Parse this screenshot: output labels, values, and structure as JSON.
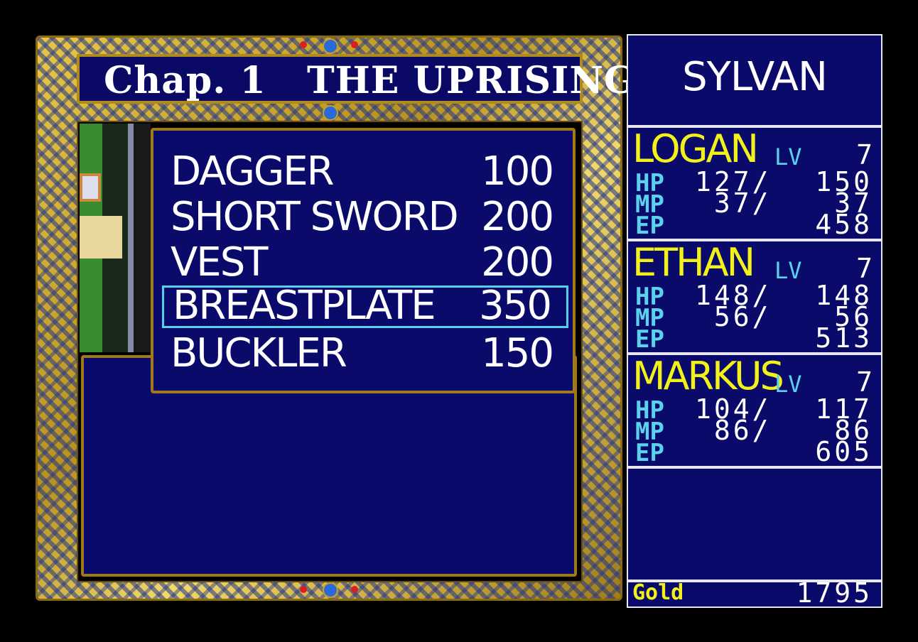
{
  "title": "Chap. 1   THE UPRISING",
  "shop_items": [
    {
      "name": "DAGGER",
      "price": "100"
    },
    {
      "name": "SHORT SWORD",
      "price": "200"
    },
    {
      "name": "VEST",
      "price": "200"
    },
    {
      "name": "BREASTPLATE",
      "price": "350"
    },
    {
      "name": "BUCKLER",
      "price": "150"
    }
  ],
  "selected_index": 3,
  "location": "SYLVAN",
  "lv_label": "LV",
  "stat_labels": {
    "hp": "HP",
    "mp": "MP",
    "ep": "EP"
  },
  "party": [
    {
      "name": "LOGAN",
      "lv": "7",
      "hp": "127/",
      "hp_max": "150",
      "mp": " 37/",
      "mp_max": "37",
      "ep": "458"
    },
    {
      "name": "ETHAN",
      "lv": "7",
      "hp": "148/",
      "hp_max": "148",
      "mp": " 56/",
      "mp_max": "56",
      "ep": "513"
    },
    {
      "name": "MARKUS",
      "lv": "7",
      "hp": "104/",
      "hp_max": "117",
      "mp": " 86/",
      "mp_max": "86",
      "ep": "605"
    }
  ],
  "gold_label": "Gold",
  "gold": "1795",
  "colors": {
    "panel_bg": "#0a0a6a",
    "name_yellow": "#f2f21a",
    "stat_cyan": "#5ad2ee",
    "frame_gold": "#d8b43a",
    "select_cyan": "#55d0e8"
  }
}
